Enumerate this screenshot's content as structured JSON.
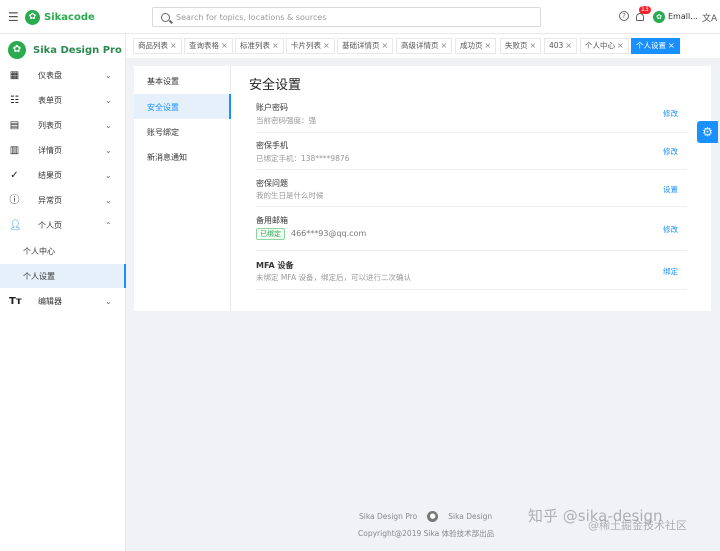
{
  "header": {
    "app_name": "Sikacode",
    "search_placeholder": "Search for topics, locations & sources",
    "notification_count": "13",
    "user_name": "Emall...",
    "help_glyph": "?",
    "translate_glyph": "文A"
  },
  "sidebar": {
    "brand": "Sika Design Pro",
    "items": [
      {
        "label": "仪表盘",
        "icon": "dashboard-icon"
      },
      {
        "label": "表单页",
        "icon": "form-icon"
      },
      {
        "label": "列表页",
        "icon": "list-icon"
      },
      {
        "label": "详情页",
        "icon": "detail-icon"
      },
      {
        "label": "结果页",
        "icon": "result-icon"
      },
      {
        "label": "异常页",
        "icon": "exception-icon"
      },
      {
        "label": "个人页",
        "icon": "user-icon"
      },
      {
        "label": "编辑器",
        "icon": "editor-icon"
      }
    ],
    "sub_items": [
      {
        "label": "个人中心"
      },
      {
        "label": "个人设置"
      }
    ]
  },
  "tabs": [
    {
      "label": "商品列表"
    },
    {
      "label": "查询表格"
    },
    {
      "label": "标准列表"
    },
    {
      "label": "卡片列表"
    },
    {
      "label": "基础详情页"
    },
    {
      "label": "高级详情页"
    },
    {
      "label": "成功页"
    },
    {
      "label": "失败页"
    },
    {
      "label": "403"
    },
    {
      "label": "个人中心"
    },
    {
      "label": "个人设置"
    }
  ],
  "settings_menu": [
    {
      "label": "基本设置"
    },
    {
      "label": "安全设置"
    },
    {
      "label": "账号绑定"
    },
    {
      "label": "新消息通知"
    }
  ],
  "security": {
    "title": "安全设置",
    "rows": [
      {
        "title": "账户密码",
        "desc": "当前密码强度：强",
        "action": "修改"
      },
      {
        "title": "密保手机",
        "desc": "已绑定手机：138****9876",
        "action": "修改"
      },
      {
        "title": "密保问题",
        "desc": "我的生日是什么时候",
        "action": "设置"
      },
      {
        "title": "备用邮箱",
        "badge": "已绑定",
        "desc": "466***93@qq.com",
        "action": "修改"
      },
      {
        "title": "MFA 设备",
        "desc": "未绑定 MFA 设备，绑定后，可以进行二次确认",
        "action": "绑定"
      }
    ]
  },
  "footer": {
    "link1": "Sika Design Pro",
    "link2": "Sika Design",
    "copyright": "Copyright@2019 Sika 体验技术部出品"
  },
  "watermark": {
    "line1": "知乎 @sika-design",
    "line2": "@稀土掘金技术社区"
  },
  "colors": {
    "brand_green": "#2aab4f",
    "primary_blue": "#1890ff",
    "badge_red": "#f5222d"
  }
}
